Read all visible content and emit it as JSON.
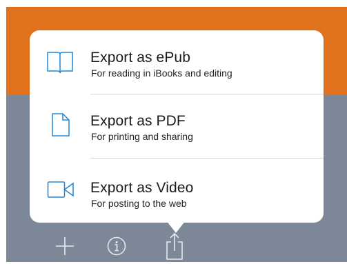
{
  "export_menu": {
    "items": [
      {
        "title": "Export as ePub",
        "subtitle": "For reading in iBooks and editing",
        "icon": "book-icon"
      },
      {
        "title": "Export as PDF",
        "subtitle": "For printing and sharing",
        "icon": "document-icon"
      },
      {
        "title": "Export as Video",
        "subtitle": "For posting to the web",
        "icon": "video-camera-icon"
      }
    ]
  },
  "toolbar": {
    "icons": [
      "plus-icon",
      "info-icon",
      "share-icon"
    ]
  },
  "colors": {
    "accent_blue": "#1e88dc",
    "orange_band": "#e0711d",
    "gray_background": "#7c8797",
    "toolbar_icon": "#e8ebef"
  }
}
